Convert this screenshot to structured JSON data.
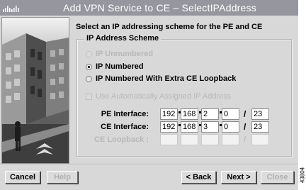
{
  "window": {
    "title": "Add VPN Service to CE – SelectIPAddress"
  },
  "content": {
    "heading": "Select an IP addressing scheme for the PE and CE",
    "group_title": "IP Address Scheme",
    "options": [
      {
        "label": "IP Unnumbered",
        "selected": false,
        "enabled": false
      },
      {
        "label": "IP Numbered",
        "selected": true,
        "enabled": true
      },
      {
        "label": "IP Numbered With Extra CE Loopback",
        "selected": false,
        "enabled": true
      }
    ],
    "auto_assign": {
      "label": "Use Automatically Assigned IP Address",
      "checked": false,
      "enabled": false
    },
    "pe_interface": {
      "label": "PE Interface:",
      "octets": [
        "192",
        "168",
        "2",
        "0"
      ],
      "prefix": "23"
    },
    "ce_interface": {
      "label": "CE Interface:",
      "octets": [
        "192",
        "168",
        "3",
        "0"
      ],
      "prefix": "23"
    },
    "ce_loopback": {
      "label": "CE Loopback :",
      "octets": [
        "",
        "",
        "",
        ""
      ],
      "prefix": "",
      "enabled": false
    },
    "slash": "/"
  },
  "buttons": {
    "cancel": "Cancel",
    "help": "Help",
    "back": "< Back",
    "next": "Next >",
    "close": "Close"
  },
  "figure_number": "43804",
  "colors": {
    "title_bar": "#96969e",
    "window_bg": "#d8d8d8",
    "disabled_text": "#b8b8b8"
  },
  "icons": {
    "title_logo": "cisco-logo-icon",
    "side_art": "building-illustration"
  }
}
